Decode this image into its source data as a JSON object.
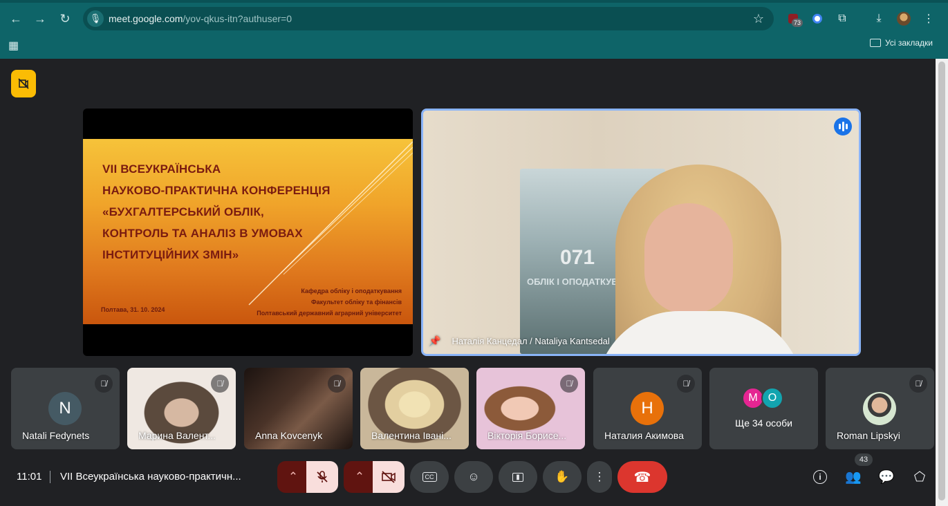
{
  "browser": {
    "url_host": "meet.google.com",
    "url_path": "/yov-qkus-itn?authuser=0",
    "extension_badge": "73",
    "bookmarks_folder": "Усі закладки",
    "colors": {
      "frame": "#0e6468",
      "omnibox": "#0a4f52"
    }
  },
  "presentation": {
    "title_lines": [
      "VII ВСЕУКРАЇНСЬКА",
      "НАУКОВО-ПРАКТИЧНА КОНФЕРЕНЦІЯ",
      "«БУХГАЛТЕРСЬКИЙ ОБЛІК,",
      "КОНТРОЛЬ ТА АНАЛІЗ В УМОВАХ",
      "ІНСТИТУЦІЙНИХ ЗМІН»"
    ],
    "org_lines": [
      "Кафедра обліку і оподаткування",
      "Факультет обліку та фінансів",
      "Полтавський державний аграрний університет"
    ],
    "date_line": "Полтава, 31. 10. 2024"
  },
  "speaker": {
    "name": "Наталія Канцедал / Nataliya Kantsedal",
    "poster_number": "071",
    "poster_caption": "ОБЛІК І ОПОДАТКУВ"
  },
  "participants": [
    {
      "name": "Natali Fedynets",
      "initial": "N",
      "avatar_color": "#455a64",
      "kind": "avatar"
    },
    {
      "name": "Марина Валент...",
      "kind": "video",
      "colors": [
        "#efe8e2",
        "#5b4a3d"
      ]
    },
    {
      "name": "Anna Kovcenyk",
      "kind": "video",
      "colors": [
        "#4a3328",
        "#1c1310"
      ]
    },
    {
      "name": "Валентина Івані...",
      "kind": "video",
      "colors": [
        "#c9b79a",
        "#6c5644"
      ]
    },
    {
      "name": "Вікторія Борисе...",
      "kind": "video",
      "colors": [
        "#e7c3d9",
        "#8c5a7a"
      ]
    },
    {
      "name": "Наталия Акимова",
      "initial": "Н",
      "avatar_color": "#e8710a",
      "kind": "avatar"
    },
    {
      "name": "Ще 34 особи",
      "kind": "more",
      "initials": [
        "М",
        "О"
      ],
      "colors": [
        "#e52592",
        "#12a4af"
      ]
    },
    {
      "name": "Roman Lipskyi",
      "kind": "photo"
    }
  ],
  "bottom_bar": {
    "time": "11:01",
    "meeting_title": "VII Всеукраїнська науково-практичн...",
    "people_count": "43"
  }
}
